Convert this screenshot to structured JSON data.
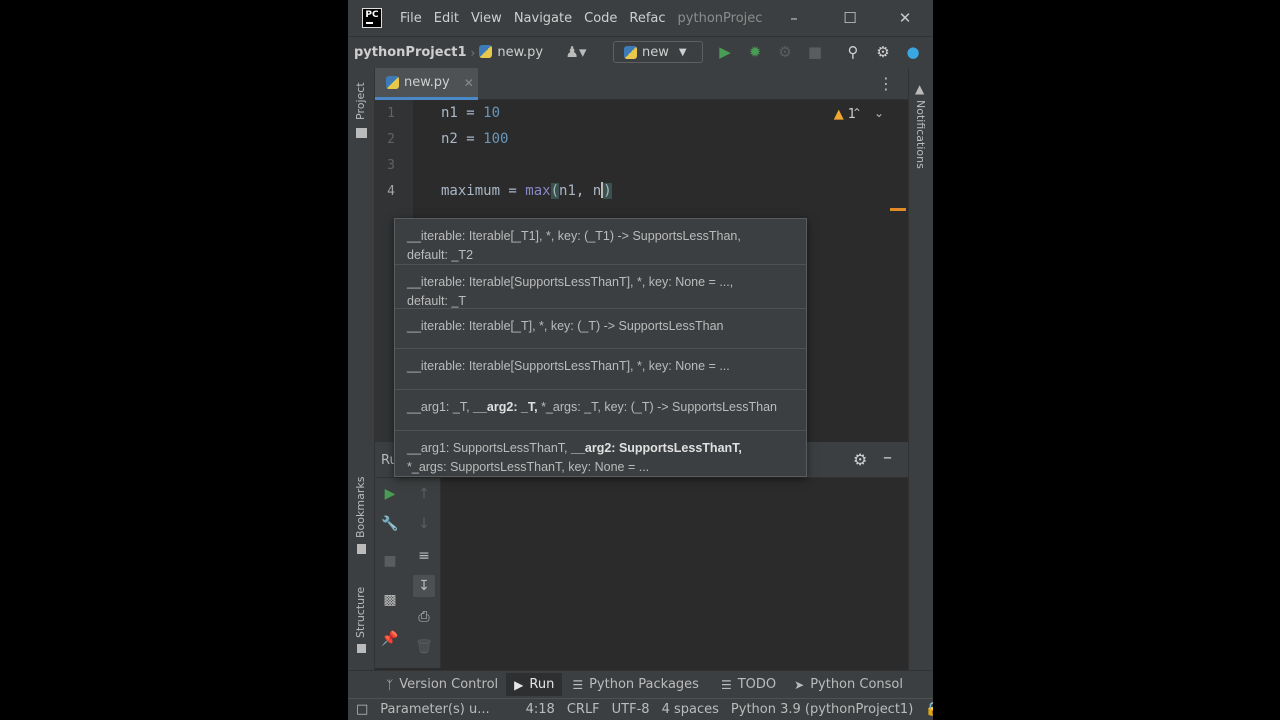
{
  "menu": {
    "items": [
      "File",
      "Edit",
      "View",
      "Navigate",
      "Code",
      "Refac"
    ],
    "project_truncated": "pythonProjec"
  },
  "navbar": {
    "project": "pythonProject1",
    "file": "new.py",
    "run_config": "new"
  },
  "left_strip": {
    "project": "Project",
    "bookmarks": "Bookmarks",
    "structure": "Structure"
  },
  "right_strip": {
    "notifications": "Notifications"
  },
  "editor": {
    "tab": "new.py",
    "warnings_count": "1",
    "line_numbers": [
      "1",
      "2",
      "3",
      "4"
    ],
    "lines": {
      "l1_var": "n1",
      "l1_eq": " = ",
      "l1_val": "10",
      "l2_var": "n2",
      "l2_eq": " = ",
      "l2_val": "100",
      "l4_var": "maximum = ",
      "l4_fn": "max",
      "l4_open": "(",
      "l4_args": "n1, n",
      "l4_close": ")"
    }
  },
  "popup": {
    "signatures": [
      {
        "pre": "__iterable: Iterable[_T1], *, key: (_T1) -> SupportsLessThan,",
        "line2": "default: _T2"
      },
      {
        "pre": "__iterable: Iterable[SupportsLessThanT], *, key: None = ...,",
        "line2": "default: _T"
      },
      {
        "pre": "__iterable: Iterable[_T], *, key: (_T) -> SupportsLessThan"
      },
      {
        "pre": "__iterable: Iterable[SupportsLessThanT], *, key: None = ..."
      },
      {
        "pre": "__arg1: _T, ",
        "bold": "__arg2: _T,",
        "post": " *_args: _T, key: (_T) -> SupportsLessThan"
      },
      {
        "pre": "__arg1: SupportsLessThanT, ",
        "bold": "__arg2: SupportsLessThanT,",
        "line2": "*_args: SupportsLessThanT, key: None = ..."
      }
    ]
  },
  "run_window": {
    "title_partial": "Ru"
  },
  "bottom_bar": {
    "version_control": "Version Control",
    "run": "Run",
    "python_packages": "Python Packages",
    "todo": "TODO",
    "python_console": "Python Consol"
  },
  "status_bar": {
    "message": "Parameter(s) u...",
    "position": "4:18",
    "line_sep": "CRLF",
    "encoding": "UTF-8",
    "indent": "4 spaces",
    "interpreter": "Python 3.9 (pythonProject1)"
  },
  "colors": {
    "accent": "#4a88c7",
    "run_green": "#499c54",
    "warning": "#f0a732"
  }
}
